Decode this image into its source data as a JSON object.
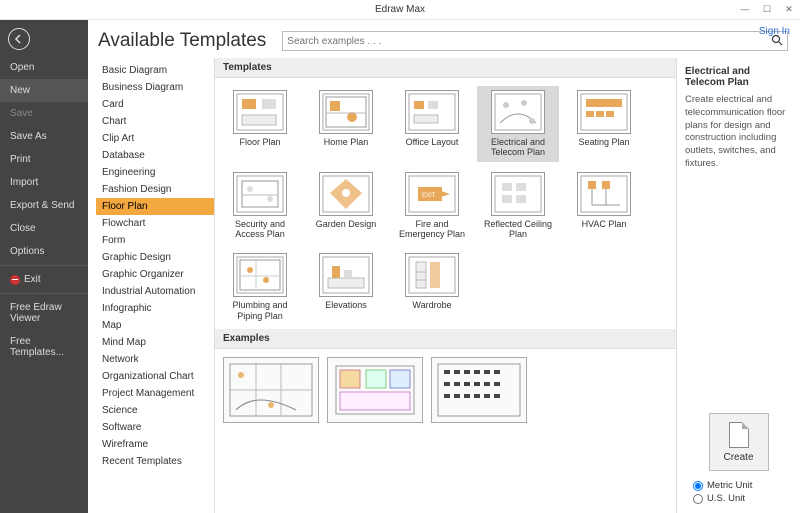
{
  "window": {
    "title": "Edraw Max",
    "min": "—",
    "max": "☐",
    "close": "✕",
    "signin": "Sign In"
  },
  "nav": {
    "items": [
      {
        "label": "Open",
        "active": false
      },
      {
        "label": "New",
        "active": true
      },
      {
        "label": "Save",
        "dim": true
      },
      {
        "label": "Save As",
        "dim": false
      },
      {
        "label": "Print",
        "dim": false
      },
      {
        "label": "Import",
        "dim": false
      },
      {
        "label": "Export & Send",
        "dim": false
      },
      {
        "label": "Close",
        "dim": false
      },
      {
        "label": "Options",
        "dim": false
      }
    ],
    "exit": "Exit",
    "extra": [
      "Free Edraw Viewer",
      "Free Templates..."
    ]
  },
  "head": {
    "title": "Available Templates",
    "search_ph": "Search examples . . ."
  },
  "categories": [
    "Basic Diagram",
    "Business Diagram",
    "Card",
    "Chart",
    "Clip Art",
    "Database",
    "Engineering",
    "Fashion Design",
    "Floor Plan",
    "Flowchart",
    "Form",
    "Graphic Design",
    "Graphic Organizer",
    "Industrial Automation",
    "Infographic",
    "Map",
    "Mind Map",
    "Network",
    "Organizational Chart",
    "Project Management",
    "Science",
    "Software",
    "Wireframe",
    "Recent Templates"
  ],
  "categories_selected": "Floor Plan",
  "sections": {
    "templates": "Templates",
    "examples": "Examples"
  },
  "templates": [
    {
      "label": "Floor Plan"
    },
    {
      "label": "Home Plan"
    },
    {
      "label": "Office Layout"
    },
    {
      "label": "Electrical and Telecom Plan",
      "selected": true
    },
    {
      "label": "Seating Plan"
    },
    {
      "label": "Security and Access Plan"
    },
    {
      "label": "Garden Design"
    },
    {
      "label": "Fire and Emergency Plan"
    },
    {
      "label": "Reflected Ceiling Plan"
    },
    {
      "label": "HVAC Plan"
    },
    {
      "label": "Plumbing and Piping Plan"
    },
    {
      "label": "Elevations"
    },
    {
      "label": "Wardrobe"
    }
  ],
  "right": {
    "title": "Electrical and Telecom Plan",
    "desc": "Create electrical and telecommunication floor plans for design and construction including outlets, switches, and fixtures.",
    "create": "Create",
    "unit_metric": "Metric Unit",
    "unit_us": "U.S. Unit",
    "unit_checked": "metric"
  },
  "colors": {
    "accent": "#f4a840",
    "exit": "#c33",
    "link": "#2a6fd6"
  }
}
